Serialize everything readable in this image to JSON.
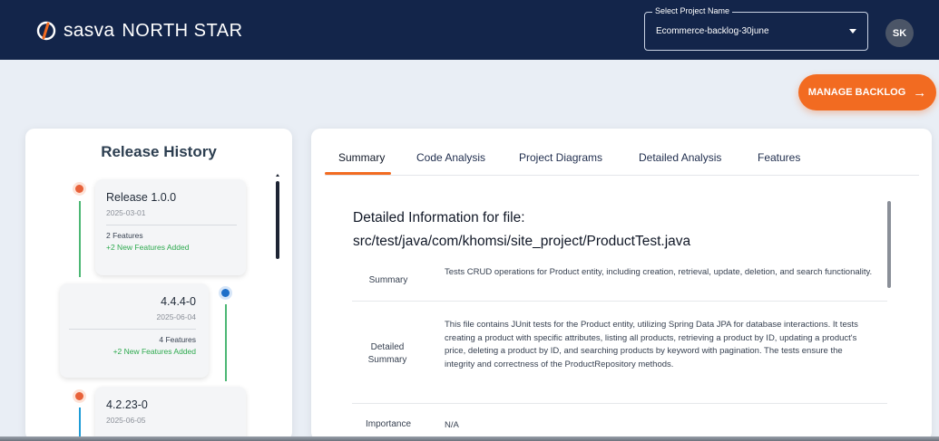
{
  "header": {
    "logo_brand": "sasva",
    "logo_product": "NORTH STAR",
    "project_select": {
      "legend": "Select Project Name",
      "value": "Ecommerce-backlog-30june"
    },
    "avatar_initials": "SK"
  },
  "actions": {
    "manage_backlog_label": "MANAGE BACKLOG"
  },
  "release_history": {
    "title": "Release History",
    "releases": [
      {
        "name": "Release 1.0.0",
        "date": "2025-03-01",
        "features": "2 Features",
        "new_features": "+2 New Features Added",
        "dot_color": "#e8623a"
      },
      {
        "name": "4.4.4-0",
        "date": "2025-06-04",
        "features": "4 Features",
        "new_features": "+2 New Features Added",
        "dot_color": "#1e6fc9"
      },
      {
        "name": "4.2.23-0",
        "date": "2025-06-05",
        "features": "",
        "new_features": "",
        "dot_color": "#e8623a"
      }
    ]
  },
  "main": {
    "tabs": [
      {
        "label": "Summary",
        "active": true
      },
      {
        "label": "Code Analysis",
        "active": false
      },
      {
        "label": "Project Diagrams",
        "active": false
      },
      {
        "label": "Detailed Analysis",
        "active": false
      },
      {
        "label": "Features",
        "active": false
      }
    ],
    "heading_line1": "Detailed Information for file:",
    "heading_line2": "src/test/java/com/khomsi/site_project/ProductTest.java",
    "rows": [
      {
        "label": "Summary",
        "value": "Tests CRUD operations for Product entity, including creation, retrieval, update, deletion, and search functionality."
      },
      {
        "label": "Detailed Summary",
        "value": "This file contains JUnit tests for the Product entity, utilizing Spring Data JPA for database interactions. It tests creating a product with specific attributes, listing all products, retrieving a product by ID, updating a product's price, deleting a product by ID, and searching products by keyword with pagination. The tests ensure the integrity and correctness of the ProductRepository methods."
      },
      {
        "label": "Importance",
        "value": "N/A"
      }
    ]
  },
  "colors": {
    "header_bg": "#13254a",
    "accent": "#f26b21",
    "success": "#2eaa4f",
    "page_bg": "#e9eef5"
  }
}
